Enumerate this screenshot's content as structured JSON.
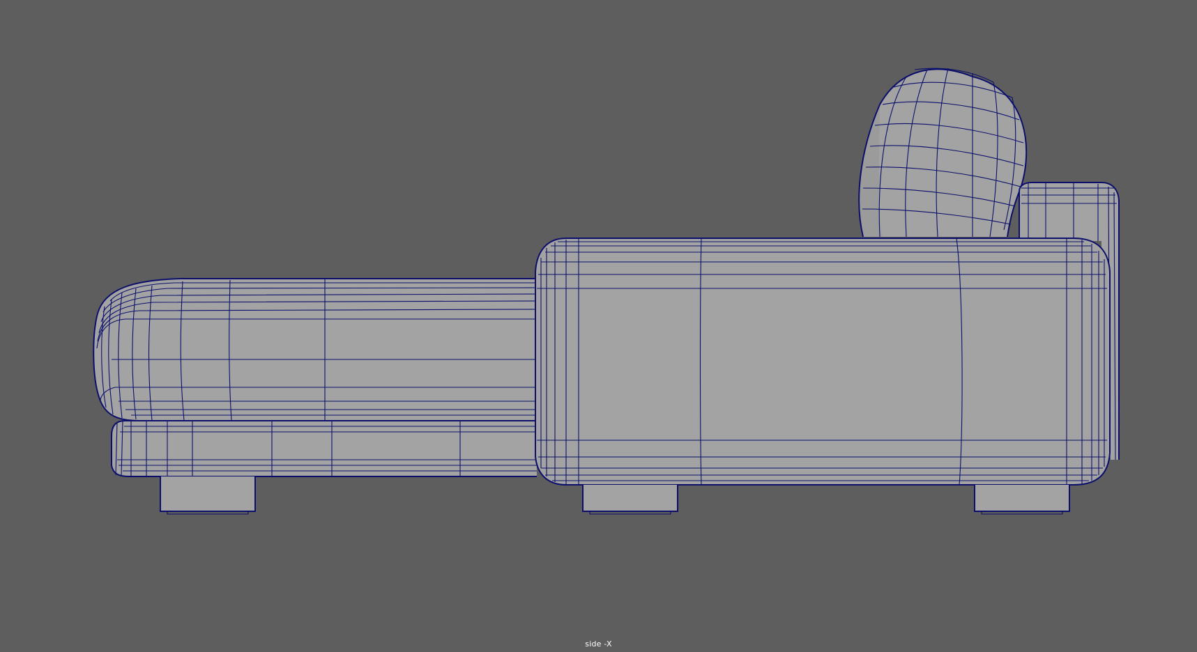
{
  "viewport": {
    "camera_label": "side -X",
    "background_color": "#5e5e5e",
    "mesh_color": "#a3a3a3",
    "wire_color": "#0b0f6b"
  }
}
